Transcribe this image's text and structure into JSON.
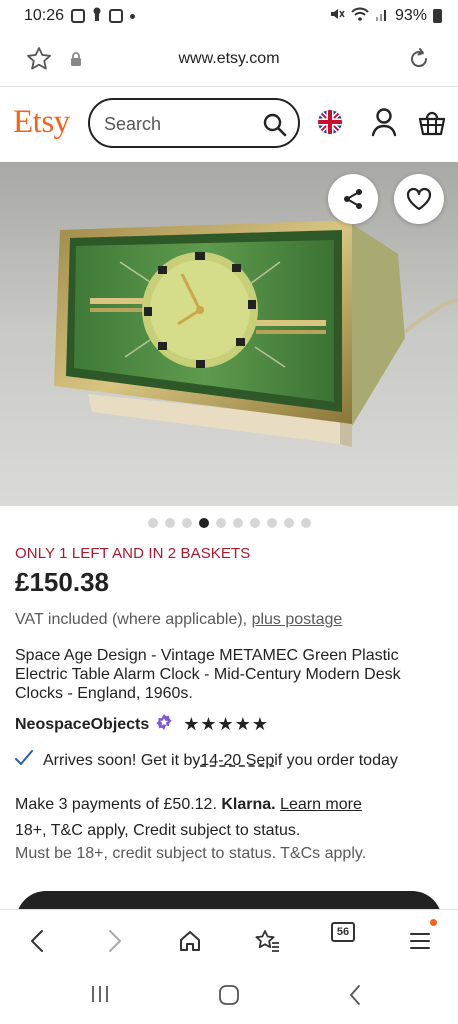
{
  "status_bar": {
    "time": "10:26",
    "battery": "93%"
  },
  "browser": {
    "url": "www.etsy.com"
  },
  "etsy_header": {
    "logo": "Etsy",
    "search_placeholder": "Search"
  },
  "carousel": {
    "total": 10,
    "active_index": 3
  },
  "listing": {
    "stock_text": "ONLY 1 LEFT AND IN 2 BASKETS",
    "price": "£150.38",
    "vat_text": "VAT included (where applicable), ",
    "postage_link": "plus postage",
    "title": "Space Age Design - Vintage METAMEC Green Plastic Electric Table Alarm Clock - Mid-Century Modern Desk Clocks - England, 1960s.",
    "shop_name": "NeospaceObjects",
    "stars": "★★★★★",
    "delivery_prefix": "Arrives soon! Get it by ",
    "delivery_dates": "14-20 Sep",
    "delivery_suffix": " if you order today",
    "payments_prefix": "Make 3 payments of £50.12. ",
    "klarna": "Klarna.",
    "learn_more": "Learn more",
    "terms_line1": "18+, T&C apply, Credit subject to status.",
    "terms_line2": "Must be 18+, credit subject to status. T&Cs apply."
  },
  "browser_nav": {
    "tab_count": "56"
  },
  "colors": {
    "etsy_orange": "#f1641e",
    "stock_red": "#a61a2e",
    "text_dark": "#222222",
    "text_muted": "#595959",
    "verified_purple": "#7f56d9"
  },
  "icons": [
    "star-icon",
    "lock-icon",
    "reload-icon",
    "search-icon",
    "uk-flag-icon",
    "user-icon",
    "basket-icon",
    "share-icon",
    "heart-icon",
    "checkmark-icon",
    "back-icon",
    "forward-icon",
    "home-icon",
    "bookmarks-icon",
    "tabs-icon",
    "menu-icon",
    "recents-icon",
    "home-circle-icon",
    "system-back-icon"
  ]
}
